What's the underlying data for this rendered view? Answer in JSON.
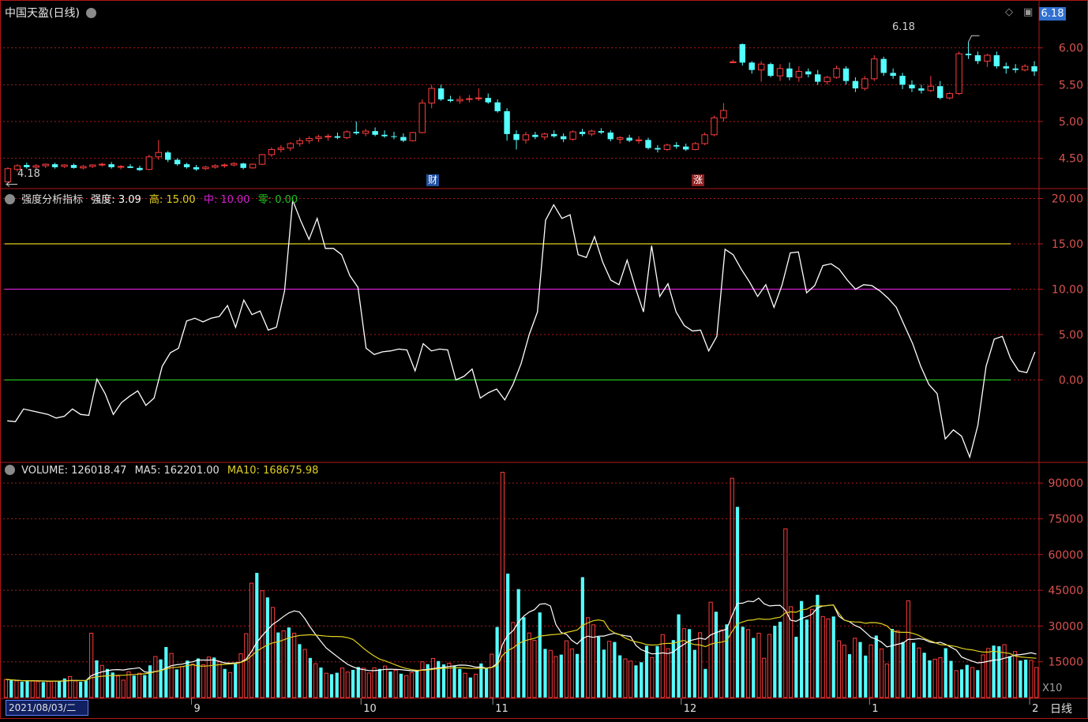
{
  "header": {
    "title": "中国天盈(日线)",
    "current_price_badge": "6.18",
    "high_marker": "6.18",
    "low_marker": "4.18",
    "event_cai": "财",
    "event_zhang": "涨"
  },
  "indicator": {
    "label": "强度分析指标",
    "strength_label": "强度:",
    "strength_value": "3.09",
    "high_label": "高:",
    "high_value": "15.00",
    "mid_label": "中:",
    "mid_value": "10.00",
    "zero_label": "零:",
    "zero_value": "0.00"
  },
  "volume": {
    "label": "VOLUME:",
    "value": "126018.47",
    "ma5_label": "MA5:",
    "ma5_value": "162201.00",
    "ma10_label": "MA10:",
    "ma10_value": "168675.98",
    "scale_note": "X10"
  },
  "footer": {
    "date_box": "2021/08/03/二",
    "period": "日线",
    "month_labels": [
      {
        "text": "9",
        "bar": 20
      },
      {
        "text": "10",
        "bar": 38
      },
      {
        "text": "11",
        "bar": 52
      },
      {
        "text": "12",
        "bar": 72
      },
      {
        "text": "1",
        "bar": 92
      },
      {
        "text": "2",
        "bar": 109
      }
    ]
  },
  "colors": {
    "up": "#ff3c3c",
    "down": "#54ffff",
    "grid": "#b01818",
    "line_white": "#ffffff",
    "line_yellow": "#e0d020",
    "line_magenta": "#d020d0",
    "line_green": "#20c020"
  },
  "chart_data": [
    {
      "type": "candlestick",
      "name": "price",
      "ylim": [
        4.1,
        6.35
      ],
      "yticks": [
        "6.00",
        "5.50",
        "5.00",
        "4.50"
      ],
      "ohlc": [
        [
          4.18,
          4.38,
          4.18,
          4.36
        ],
        [
          4.35,
          4.42,
          4.32,
          4.4
        ],
        [
          4.41,
          4.44,
          4.36,
          4.38
        ],
        [
          4.38,
          4.42,
          4.35,
          4.4
        ],
        [
          4.4,
          4.43,
          4.37,
          4.42
        ],
        [
          4.42,
          4.44,
          4.36,
          4.38
        ],
        [
          4.39,
          4.42,
          4.37,
          4.41
        ],
        [
          4.41,
          4.43,
          4.36,
          4.37
        ],
        [
          4.37,
          4.41,
          4.35,
          4.39
        ],
        [
          4.39,
          4.42,
          4.37,
          4.41
        ],
        [
          4.41,
          4.44,
          4.39,
          4.42
        ],
        [
          4.42,
          4.45,
          4.36,
          4.38
        ],
        [
          4.38,
          4.41,
          4.35,
          4.39
        ],
        [
          4.39,
          4.42,
          4.37,
          4.37
        ],
        [
          4.37,
          4.4,
          4.33,
          4.34
        ],
        [
          4.35,
          4.55,
          4.34,
          4.52
        ],
        [
          4.52,
          4.75,
          4.48,
          4.58
        ],
        [
          4.58,
          4.6,
          4.45,
          4.48
        ],
        [
          4.48,
          4.5,
          4.4,
          4.42
        ],
        [
          4.42,
          4.44,
          4.36,
          4.38
        ],
        [
          4.38,
          4.41,
          4.33,
          4.35
        ],
        [
          4.36,
          4.4,
          4.34,
          4.38
        ],
        [
          4.38,
          4.42,
          4.36,
          4.4
        ],
        [
          4.4,
          4.43,
          4.37,
          4.41
        ],
        [
          4.41,
          4.45,
          4.39,
          4.43
        ],
        [
          4.43,
          4.44,
          4.35,
          4.37
        ],
        [
          4.37,
          4.43,
          4.36,
          4.42
        ],
        [
          4.42,
          4.56,
          4.41,
          4.55
        ],
        [
          4.55,
          4.65,
          4.52,
          4.62
        ],
        [
          4.62,
          4.68,
          4.58,
          4.64
        ],
        [
          4.64,
          4.72,
          4.6,
          4.7
        ],
        [
          4.7,
          4.78,
          4.66,
          4.74
        ],
        [
          4.74,
          4.8,
          4.7,
          4.77
        ],
        [
          4.77,
          4.82,
          4.72,
          4.79
        ],
        [
          4.79,
          4.83,
          4.74,
          4.8
        ],
        [
          4.8,
          4.85,
          4.76,
          4.78
        ],
        [
          4.78,
          4.88,
          4.76,
          4.86
        ],
        [
          4.86,
          5.0,
          4.82,
          4.84
        ],
        [
          4.84,
          4.9,
          4.8,
          4.87
        ],
        [
          4.87,
          4.92,
          4.8,
          4.82
        ],
        [
          4.82,
          4.88,
          4.78,
          4.8
        ],
        [
          4.8,
          4.86,
          4.76,
          4.79
        ],
        [
          4.79,
          4.84,
          4.72,
          4.74
        ],
        [
          4.74,
          4.86,
          4.73,
          4.85
        ],
        [
          4.85,
          5.3,
          4.84,
          5.25
        ],
        [
          5.25,
          5.5,
          5.18,
          5.45
        ],
        [
          5.45,
          5.5,
          5.28,
          5.3
        ],
        [
          5.3,
          5.35,
          5.26,
          5.28
        ],
        [
          5.28,
          5.35,
          5.24,
          5.3
        ],
        [
          5.3,
          5.36,
          5.26,
          5.31
        ],
        [
          5.31,
          5.45,
          5.28,
          5.32
        ],
        [
          5.32,
          5.38,
          5.24,
          5.26
        ],
        [
          5.26,
          5.3,
          5.12,
          5.14
        ],
        [
          5.14,
          5.18,
          4.74,
          4.83
        ],
        [
          4.83,
          4.88,
          4.62,
          4.75
        ],
        [
          4.75,
          4.86,
          4.7,
          4.82
        ],
        [
          4.82,
          4.86,
          4.76,
          4.79
        ],
        [
          4.79,
          4.85,
          4.75,
          4.83
        ],
        [
          4.83,
          4.88,
          4.78,
          4.8
        ],
        [
          4.8,
          4.84,
          4.72,
          4.76
        ],
        [
          4.76,
          4.88,
          4.74,
          4.86
        ],
        [
          4.86,
          4.9,
          4.8,
          4.83
        ],
        [
          4.83,
          4.89,
          4.8,
          4.87
        ],
        [
          4.87,
          4.91,
          4.83,
          4.85
        ],
        [
          4.85,
          4.88,
          4.73,
          4.76
        ],
        [
          4.76,
          4.8,
          4.7,
          4.78
        ],
        [
          4.78,
          4.82,
          4.72,
          4.74
        ],
        [
          4.74,
          4.8,
          4.7,
          4.75
        ],
        [
          4.75,
          4.78,
          4.62,
          4.64
        ],
        [
          4.64,
          4.68,
          4.58,
          4.62
        ],
        [
          4.62,
          4.7,
          4.6,
          4.68
        ],
        [
          4.68,
          4.72,
          4.63,
          4.66
        ],
        [
          4.66,
          4.7,
          4.6,
          4.62
        ],
        [
          4.62,
          4.72,
          4.61,
          4.7
        ],
        [
          4.7,
          4.85,
          4.68,
          4.82
        ],
        [
          4.82,
          5.08,
          4.8,
          5.05
        ],
        [
          5.05,
          5.25,
          5.0,
          5.15
        ],
        [
          5.8,
          5.84,
          5.8,
          5.81
        ],
        [
          6.05,
          6.06,
          5.76,
          5.8
        ],
        [
          5.8,
          5.82,
          5.65,
          5.7
        ],
        [
          5.7,
          5.82,
          5.54,
          5.78
        ],
        [
          5.78,
          5.8,
          5.6,
          5.62
        ],
        [
          5.62,
          5.78,
          5.55,
          5.72
        ],
        [
          5.72,
          5.8,
          5.56,
          5.6
        ],
        [
          5.6,
          5.75,
          5.54,
          5.68
        ],
        [
          5.68,
          5.72,
          5.6,
          5.64
        ],
        [
          5.64,
          5.7,
          5.5,
          5.54
        ],
        [
          5.54,
          5.62,
          5.5,
          5.6
        ],
        [
          5.6,
          5.76,
          5.58,
          5.72
        ],
        [
          5.72,
          5.75,
          5.5,
          5.55
        ],
        [
          5.55,
          5.6,
          5.4,
          5.45
        ],
        [
          5.45,
          5.62,
          5.42,
          5.58
        ],
        [
          5.58,
          5.9,
          5.55,
          5.85
        ],
        [
          5.85,
          5.88,
          5.62,
          5.66
        ],
        [
          5.66,
          5.72,
          5.58,
          5.62
        ],
        [
          5.62,
          5.66,
          5.44,
          5.5
        ],
        [
          5.5,
          5.56,
          5.4,
          5.45
        ],
        [
          5.45,
          5.5,
          5.38,
          5.42
        ],
        [
          5.42,
          5.62,
          5.4,
          5.48
        ],
        [
          5.48,
          5.55,
          5.3,
          5.32
        ],
        [
          5.32,
          5.4,
          5.3,
          5.38
        ],
        [
          5.38,
          5.95,
          5.36,
          5.92
        ],
        [
          5.92,
          6.08,
          5.85,
          5.9
        ],
        [
          5.9,
          5.95,
          5.78,
          5.82
        ],
        [
          5.82,
          5.92,
          5.74,
          5.9
        ],
        [
          5.9,
          5.95,
          5.72,
          5.75
        ],
        [
          5.75,
          5.8,
          5.65,
          5.72
        ],
        [
          5.72,
          5.78,
          5.66,
          5.7
        ],
        [
          5.7,
          5.78,
          5.68,
          5.75
        ],
        [
          5.75,
          5.82,
          5.62,
          5.68
        ]
      ]
    },
    {
      "type": "line",
      "name": "强度",
      "ylim": [
        -9,
        21
      ],
      "yticks": [
        "20.00",
        "15.00",
        "10.00",
        "5.00",
        "0.00"
      ],
      "reference_lines": [
        15,
        10,
        0
      ],
      "values": [
        -4.5,
        -4.6,
        -3.2,
        -3.4,
        -3.6,
        -3.8,
        -4.2,
        -4.0,
        -3.2,
        -3.8,
        -3.9,
        0.1,
        -1.5,
        -3.8,
        -2.5,
        -1.8,
        -1.2,
        -2.8,
        -2.0,
        1.5,
        3.0,
        3.5,
        6.5,
        6.8,
        6.4,
        6.8,
        7.0,
        8.2,
        5.8,
        8.8,
        7.2,
        7.6,
        5.5,
        5.8,
        9.8,
        19.8,
        17.5,
        15.5,
        17.8,
        14.5,
        14.5,
        13.8,
        11.5,
        10.2,
        3.5,
        2.8,
        3.1,
        3.2,
        3.4,
        3.3,
        1.0,
        4.0,
        3.2,
        3.4,
        3.3,
        0.0,
        0.4,
        1.2,
        -2.0,
        -1.4,
        -1.0,
        -2.2,
        -0.5,
        1.8,
        5.0,
        7.5,
        17.6,
        19.3,
        17.8,
        18.2,
        13.8,
        13.5,
        15.8,
        13.0,
        11.0,
        10.5,
        13.2,
        10.2,
        7.5,
        14.8,
        9.2,
        10.6,
        7.5,
        6.0,
        5.4,
        5.5,
        3.2,
        4.8,
        14.4,
        13.8,
        12.2,
        10.8,
        9.2,
        10.5,
        8.0,
        10.5,
        14.0,
        14.1,
        9.6,
        10.4,
        12.6,
        12.8,
        12.2,
        11.0,
        10.0,
        10.5,
        10.4,
        9.8,
        9.0,
        8.0,
        6.0,
        4.0,
        1.5,
        -0.5,
        -1.5,
        -6.5,
        -5.5,
        -6.2,
        -8.5,
        -5.0,
        1.5,
        4.5,
        4.8,
        2.4,
        1.0,
        0.8,
        3.09
      ]
    },
    {
      "type": "bar",
      "name": "VOLUME",
      "ylim": [
        0,
        98000
      ],
      "yticks": [
        "90000",
        "75000",
        "60000",
        "45000",
        "30000",
        "15000"
      ],
      "values": [
        7600,
        7200,
        7000,
        6600,
        7000,
        6900,
        6700,
        6500,
        6700,
        6900,
        7100,
        8000,
        8800,
        7000,
        6600,
        7100,
        27000,
        15600,
        13500,
        12000,
        10500,
        9000,
        7300,
        10800,
        9200,
        10200,
        9400,
        13500,
        17200,
        16000,
        21200,
        18500,
        11800,
        13000,
        15500,
        14000,
        16400,
        13800,
        17000,
        16800,
        15000,
        12000,
        10500,
        14500,
        18400,
        26800,
        48000,
        52300,
        44800,
        42000,
        37800,
        27300,
        28000,
        29400,
        27000,
        22400,
        20200,
        16600,
        14200,
        12600,
        10200,
        9800,
        10400,
        12400,
        10700,
        11600,
        12800,
        12300,
        10300,
        12500,
        12000,
        13200,
        10900,
        11500,
        10000,
        9200,
        10500,
        11300,
        15000,
        14000,
        16400,
        15300,
        13900,
        14400,
        13200,
        12000,
        10200,
        8400,
        9800,
        14300,
        12300,
        18200,
        29600,
        94500,
        52000,
        31500,
        45500,
        33700,
        27100,
        24000,
        35700,
        20400,
        19800,
        17200,
        18000,
        23800,
        20400,
        18300,
        50500,
        33500,
        30500,
        25500,
        20100,
        23600,
        23300,
        17700,
        16200,
        15300,
        13500,
        14800,
        21700,
        16800,
        21600,
        26400,
        20500,
        24100,
        34900,
        28900,
        28700,
        20000,
        27200,
        12000,
        40000,
        36000,
        28400,
        30700,
        92000,
        80000,
        29700,
        28500,
        25000,
        27000,
        16500,
        26500,
        30100,
        31800,
        70800,
        38100,
        25500,
        40500,
        32700,
        37000,
        43100,
        34000,
        33000,
        34000,
        23800,
        22000,
        18200,
        24900,
        23300,
        17600,
        22100,
        26000,
        20400,
        14100,
        28800,
        28000,
        23300,
        40600,
        23000,
        20800,
        18800,
        15600,
        16100,
        16700,
        20700,
        15400,
        11300,
        11800,
        13700,
        12600,
        11500,
        17900,
        20600,
        21800,
        21500,
        22200,
        17300,
        19300,
        15500,
        15900,
        15600,
        12600
      ]
    }
  ]
}
